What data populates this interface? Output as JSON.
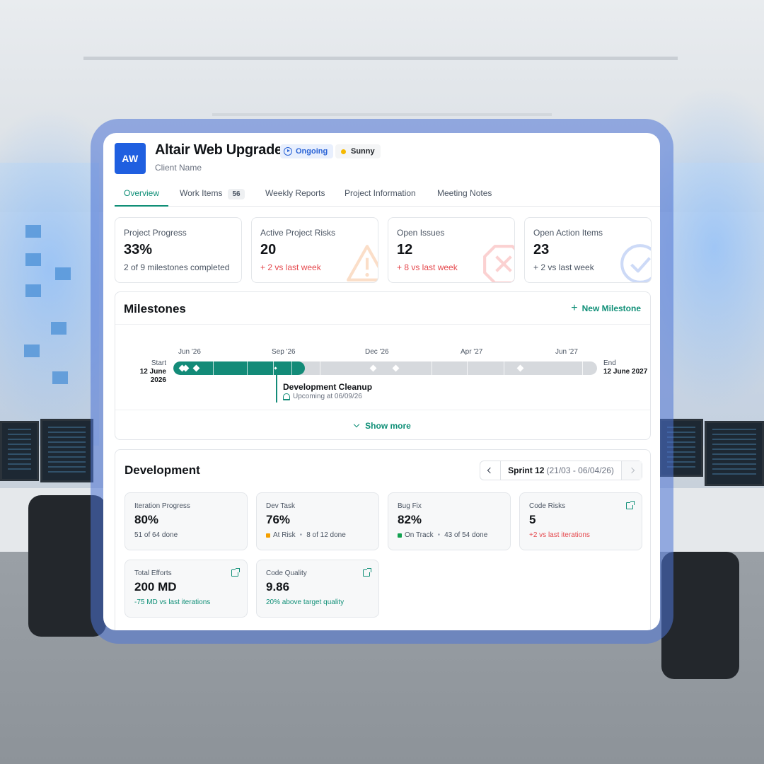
{
  "project": {
    "initials": "AW",
    "title": "Altair Web Upgrade",
    "client": "Client Name",
    "status": "Ongoing",
    "weather": "Sunny"
  },
  "tabs": [
    {
      "label": "Overview",
      "active": true
    },
    {
      "label": "Work Items",
      "count": "56"
    },
    {
      "label": "Weekly Reports"
    },
    {
      "label": "Project Information"
    },
    {
      "label": "Meeting Notes"
    }
  ],
  "stats": [
    {
      "label": "Project Progress",
      "value": "33%",
      "sub": "2 of 9 milestones completed",
      "icon": "none"
    },
    {
      "label": "Active Project Risks",
      "value": "20",
      "sub": "+ 2 vs last week",
      "icon": "warning-icon"
    },
    {
      "label": "Open Issues",
      "value": "12",
      "sub": "+ 8 vs  last week",
      "icon": "close-icon"
    },
    {
      "label": "Open Action Items",
      "value": "23",
      "sub": "+ 2 vs  last week",
      "icon": "check-icon"
    }
  ],
  "milestones": {
    "title": "Milestones",
    "new_label": "New Milestone",
    "ticks": [
      "Jun '26",
      "Sep '26",
      "Dec '26",
      "Apr '27",
      "Jun '27"
    ],
    "start_label": "Start",
    "start_date": "12 June 2026",
    "end_label": "End",
    "end_date": "12 June 2027",
    "progress_fraction": 0.31,
    "next": {
      "title": "Development Cleanup",
      "subtitle": "Upcoming at 06/09/26"
    },
    "show_more": "Show more"
  },
  "development": {
    "title": "Development",
    "sprint_name": "Sprint 12",
    "sprint_dates": "(21/03 - 06/04/26)",
    "metrics": [
      {
        "label": "Iteration Progress",
        "value": "80%",
        "sub": "51 of 64 done"
      },
      {
        "label": "Dev Task",
        "value": "76%",
        "status": "At Risk",
        "status_color": "#f5a000",
        "detail": "8 of 12 done"
      },
      {
        "label": "Bug Fix",
        "value": "82%",
        "status": "On Track",
        "status_color": "#12a150",
        "detail": "43 of 54 done"
      },
      {
        "label": "Code Risks",
        "value": "5",
        "sub": "+2 vs last iterations"
      },
      {
        "label": "Total Efforts",
        "value": "200 MD",
        "sub": "-75 MD vs last iterations"
      },
      {
        "label": "Code Quality",
        "value": "9.86",
        "sub": "20% above target quality"
      }
    ]
  },
  "colors": {
    "accent": "#0f8f77",
    "brand": "#1f5fe0",
    "danger": "#e5484d",
    "frame": "#4e74d6"
  }
}
